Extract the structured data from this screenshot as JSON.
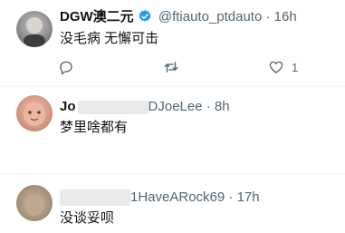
{
  "tweets": [
    {
      "name": "DGW澳二元",
      "handle": "@ftiauto_ptdauto",
      "time": "16h",
      "text": "没毛病 无懈可击",
      "verified": true,
      "likes": "1"
    },
    {
      "name": "Jo",
      "handle": "DJoeLee",
      "time": "8h",
      "text": "梦里啥都有"
    },
    {
      "name": "",
      "handle": "1HaveARock69",
      "time": "17h",
      "text": "没谈妥呗"
    }
  ],
  "separator_dot": "·",
  "icons": [
    "reply-icon",
    "retweet-icon",
    "like-icon",
    "share-icon",
    "verified-badge-icon"
  ],
  "colors": {
    "text": "#0f1419",
    "muted": "#536471",
    "verified": "#1d9bf0",
    "divider": "#eff3f4"
  }
}
